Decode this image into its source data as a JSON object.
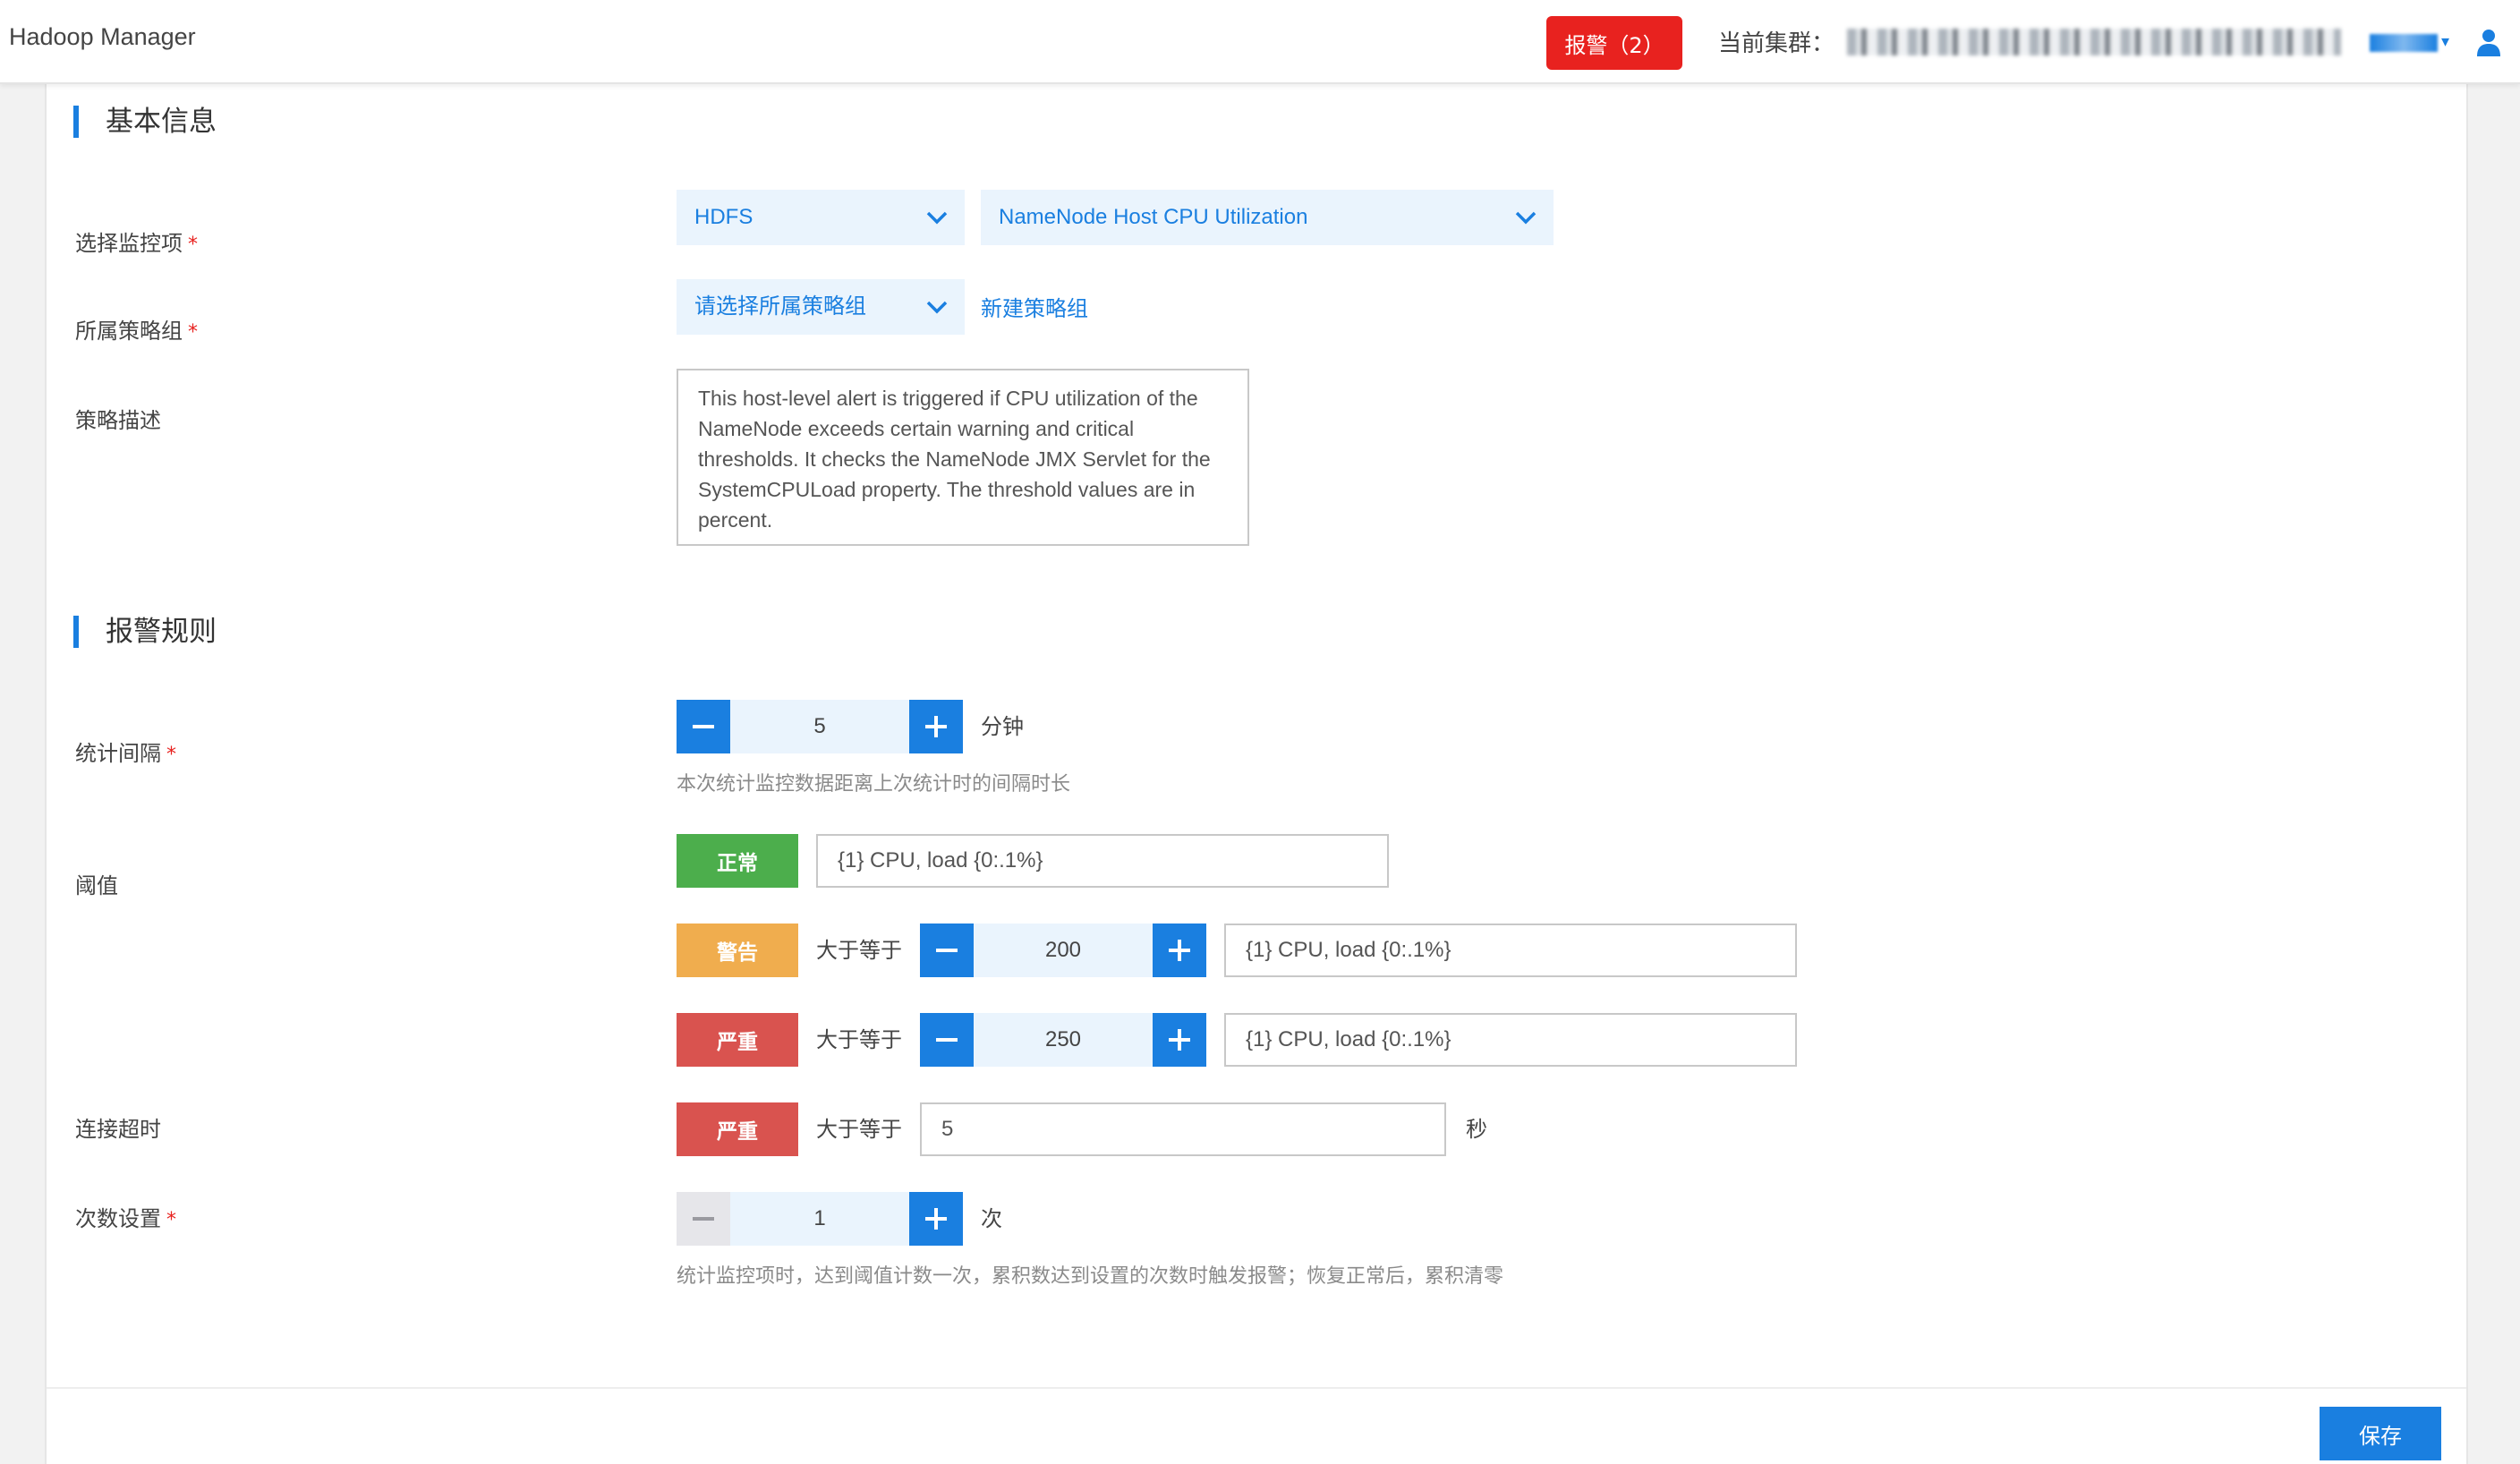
{
  "header": {
    "app_title": "Hadoop Manager",
    "alert_label": "报警（2）",
    "cluster_label": "当前集群："
  },
  "basic_info": {
    "title": "基本信息",
    "monitor_item": {
      "label": "选择监控项",
      "required_mark": "*",
      "service_value": "HDFS",
      "metric_value": "NameNode Host CPU Utilization"
    },
    "policy_group": {
      "label": "所属策略组",
      "required_mark": "*",
      "placeholder": "请选择所属策略组",
      "new_link": "新建策略组"
    },
    "description": {
      "label": "策略描述",
      "text": "This host-level alert is triggered if CPU utilization of the NameNode exceeds certain warning and critical thresholds. It checks the NameNode JMX Servlet for the SystemCPULoad property. The threshold values are in percent."
    }
  },
  "alert_rules": {
    "title": "报警规则",
    "interval": {
      "label": "统计间隔",
      "required_mark": "*",
      "value": "5",
      "unit": "分钟",
      "hint": "本次统计监控数据距离上次统计时的间隔时长"
    },
    "threshold": {
      "label": "阈值",
      "normal": {
        "badge": "正常",
        "message": "{1} CPU, load {0:.1%}"
      },
      "warning": {
        "badge": "警告",
        "op": "大于等于",
        "value": "200",
        "message": "{1} CPU, load {0:.1%}"
      },
      "critical": {
        "badge": "严重",
        "op": "大于等于",
        "value": "250",
        "message": "{1} CPU, load {0:.1%}"
      }
    },
    "timeout": {
      "label": "连接超时",
      "badge": "严重",
      "op": "大于等于",
      "value": "5",
      "unit": "秒"
    },
    "count": {
      "label": "次数设置",
      "required_mark": "*",
      "value": "1",
      "unit": "次",
      "hint": "统计监控项时，达到阈值计数一次，累积数达到设置的次数时触发报警；恢复正常后，累积清零"
    }
  },
  "footer": {
    "save_label": "保存"
  },
  "colors": {
    "primary": "#1a7fe0",
    "danger": "#e8221f",
    "normal_badge": "#4cae4c",
    "warning_badge": "#f0ad4e",
    "critical_badge": "#d9534f"
  }
}
